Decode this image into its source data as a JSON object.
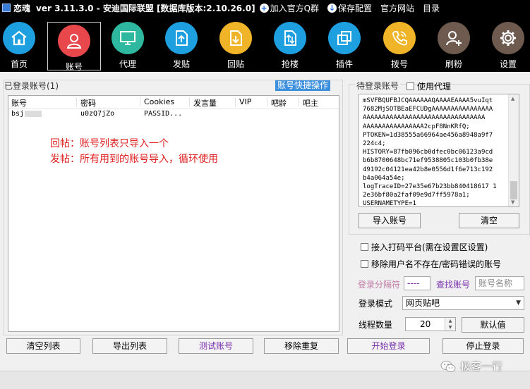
{
  "titlebar": {
    "app_name": "恋魂",
    "version": "ver 3.11.3.0 - 安迪国际联盟 [数据库版本:2.10.26.0]",
    "menu": [
      {
        "label": "加入官方Q群",
        "icon": "plus-circle-icon"
      },
      {
        "label": "保存配置",
        "icon": "download-circle-icon"
      },
      {
        "label": "官方网站"
      },
      {
        "label": "目录"
      }
    ]
  },
  "toolbar": [
    {
      "label": "首页",
      "icon": "home-icon",
      "color": "#1e9fe0"
    },
    {
      "label": "账号",
      "icon": "user-icon",
      "color": "#e8474c"
    },
    {
      "label": "代理",
      "icon": "monitor-icon",
      "color": "#2eb8a0"
    },
    {
      "label": "发贴",
      "icon": "upload-doc-icon",
      "color": "#1e9fe0"
    },
    {
      "label": "回贴",
      "icon": "download-doc-icon",
      "color": "#f0b429"
    },
    {
      "label": "抢楼",
      "icon": "transfer-doc-icon",
      "color": "#1e9fe0"
    },
    {
      "label": "插件",
      "icon": "plugin-icon",
      "color": "#1e9fe0"
    },
    {
      "label": "拨号",
      "icon": "phone-icon",
      "color": "#f0b429"
    },
    {
      "label": "刷粉",
      "icon": "add-user-icon",
      "color": "#6e5a4e"
    },
    {
      "label": "设置",
      "icon": "gear-icon",
      "color": "#6e5a4e"
    }
  ],
  "accounts": {
    "section_label": "已登录账号(1)",
    "quick_action": "账号快捷操作",
    "columns": [
      "账号",
      "密码",
      "Cookies",
      "发言量",
      "VIP",
      "吧龄",
      "吧主"
    ],
    "rows": [
      {
        "account": "bsj",
        "password": "u0zQ7jZo",
        "cookies": "PASSID..."
      }
    ],
    "notes": [
      "回帖：账号列表只导入一个",
      "发帖：所有用到的账号导入，循环使用"
    ]
  },
  "left_buttons": [
    "清空列表",
    "导出列表",
    "测试账号",
    "移除重复"
  ],
  "pending": {
    "label": "待登录账号",
    "use_proxy": "使用代理",
    "cookies_text": "mSVFBQUFBJCQAAAAAAQAAAAEAAAA5vuIqt\n7682MjSOTBEaEFCUDgAAAAAAAAAAAAAAAA\nAAAAAAAAAAAAAAAAAAAAAAAAAAAAAAAA\nAAAAAAAAAAAAAAAA2cpF8NnKRfQ;\nPTOKEN=1d38555a66964ae456a8948a9f7\n224c4;\nHISTORY=87fb096cb0dfec0bc06123a9cd\nb6b8700648bc71ef9538805c103b0fb38e\n49192c04121ea42b8e0556d1f6e713c192\nb4a064a54e;\nlogTraceID=27e35e67b23bb840418617 1\n2e36bf80a2faf09e9d7ff5978a1;\nUSERNAMETYPE=1",
    "import_button": "导入账号",
    "clear_button": "清空"
  },
  "options": {
    "captcha_platform": "接入打码平台(需在设置区设置)",
    "remove_invalid": "移除用户名不存在/密码错误的账号",
    "separator_label": "登录分隔符",
    "separator_value": "----",
    "find_account": "查找账号",
    "account_name_placeholder": "账号名称",
    "login_mode_label": "登录模式",
    "login_mode_value": "网页贴吧",
    "thread_count_label": "线程数量",
    "thread_count_value": "20",
    "default_button": "默认值",
    "start_login": "开始登录",
    "stop_login": "停止登录"
  },
  "watermark": "极客一行",
  "colors": {
    "accent": "#3b8fdc",
    "note": "#e02020",
    "link": "#7a2fae"
  }
}
